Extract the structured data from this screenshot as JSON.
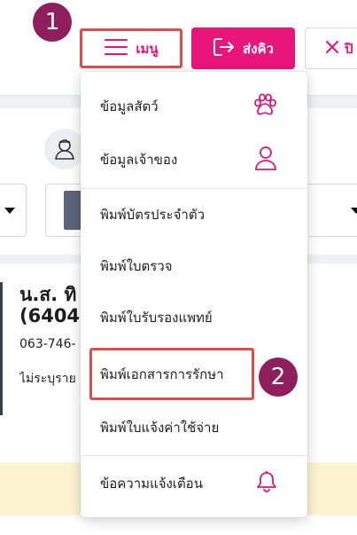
{
  "header": {
    "step1": "1",
    "menu_label": "เมนู",
    "queue_label": "ส่งคิว",
    "close_label": "ปิ"
  },
  "owner": {
    "name_line1": "น.ส. ทิ",
    "name_line2": "(6404",
    "phone": "063-746-",
    "note": "ไม่ระบุราย"
  },
  "menu": {
    "items": [
      {
        "label": "ข้อมูลสัตว์",
        "icon": "paw-icon"
      },
      {
        "label": "ข้อมูลเจ้าของ",
        "icon": "person-icon"
      },
      {
        "label": "พิมพ์บัตรประจำตัว"
      },
      {
        "label": "พิมพ์ใบตรวจ"
      },
      {
        "label": "พิมพ์ใบรับรองแพทย์"
      },
      {
        "label": "พิมพ์เอกสารการรักษา"
      },
      {
        "label": "พิมพ์ใบแจ้งค่าใช้จ่าย"
      },
      {
        "label": "ข้อความแจ้งเตือน",
        "icon": "bell-icon"
      }
    ]
  },
  "step2": "2",
  "colors": {
    "accent": "#e8157b",
    "badge": "#8e1f5c",
    "highlight": "#e04b4b"
  }
}
